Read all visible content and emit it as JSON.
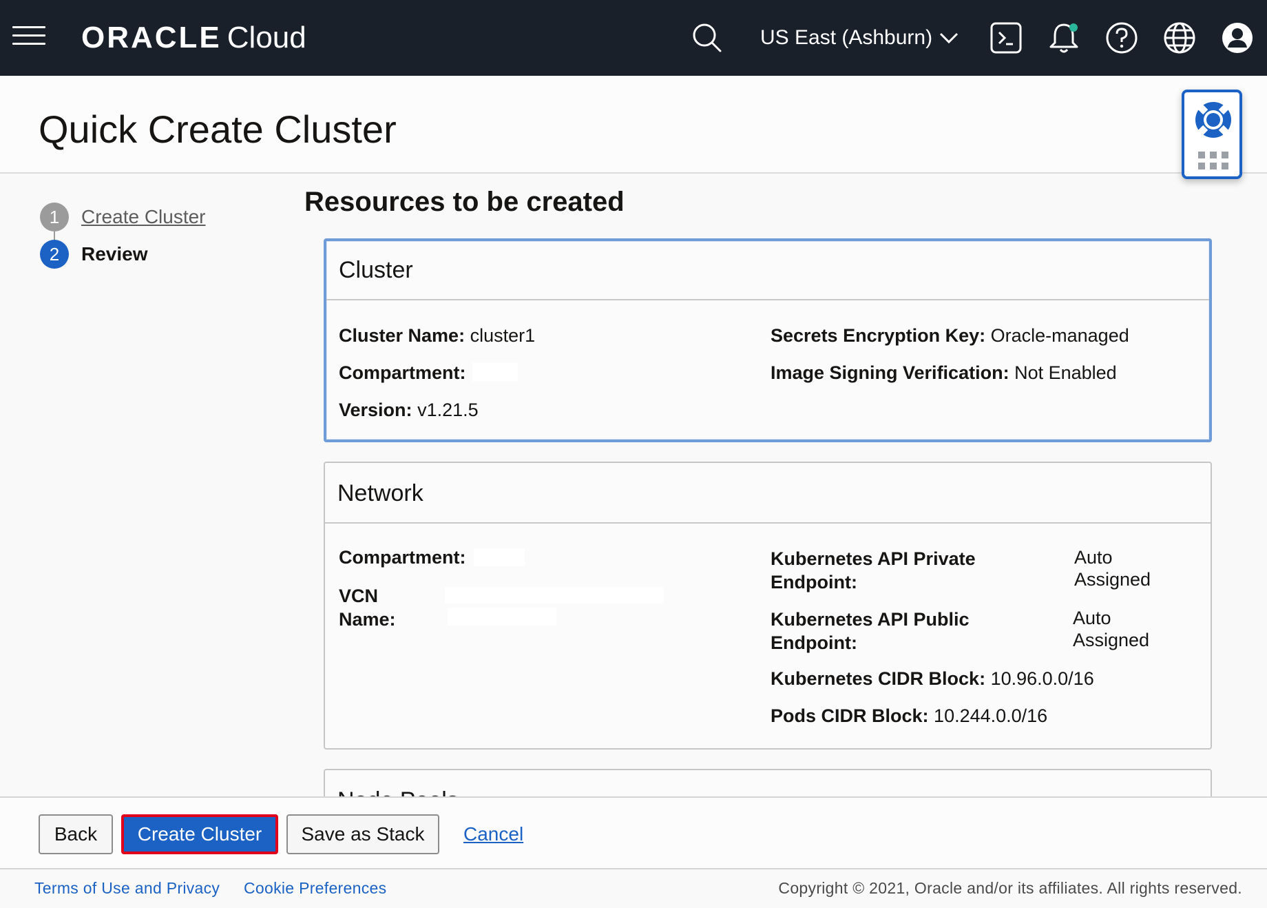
{
  "header": {
    "brand_oracle": "ORACLE",
    "brand_cloud": "Cloud",
    "region": "US East (Ashburn)"
  },
  "page": {
    "title": "Quick Create Cluster",
    "section_heading": "Resources to be created"
  },
  "steps": [
    {
      "number": "1",
      "label": "Create Cluster",
      "state": "completed"
    },
    {
      "number": "2",
      "label": "Review",
      "state": "current"
    }
  ],
  "cluster_panel": {
    "title": "Cluster",
    "cluster_name_label": "Cluster Name:",
    "cluster_name_value": "cluster1",
    "compartment_label": "Compartment:",
    "version_label": "Version:",
    "version_value": "v1.21.5",
    "secrets_label": "Secrets Encryption Key:",
    "secrets_value": "Oracle-managed",
    "image_signing_label": "Image Signing Verification:",
    "image_signing_value": "Not Enabled"
  },
  "network_panel": {
    "title": "Network",
    "compartment_label": "Compartment:",
    "vcn_label_line1": "VCN",
    "vcn_label_line2": "Name:",
    "api_private_label_line1": "Kubernetes API Private",
    "api_private_label_line2": "Endpoint:",
    "api_private_value_line1": "Auto",
    "api_private_value_line2": "Assigned",
    "api_public_label_line1": "Kubernetes API Public",
    "api_public_label_line2": "Endpoint:",
    "api_public_value_line1": "Auto",
    "api_public_value_line2": "Assigned",
    "k8s_cidr_label": "Kubernetes CIDR Block:",
    "k8s_cidr_value": "10.96.0.0/16",
    "pods_cidr_label": "Pods CIDR Block:",
    "pods_cidr_value": "10.244.0.0/16"
  },
  "node_pools_panel": {
    "title": "Node Pools"
  },
  "actions": {
    "back": "Back",
    "create_cluster": "Create Cluster",
    "save_as_stack": "Save as Stack",
    "cancel": "Cancel"
  },
  "footer": {
    "terms": "Terms of Use and Privacy",
    "cookies": "Cookie Preferences",
    "copyright": "Copyright © 2021, Oracle and/or its affiliates. All rights reserved."
  },
  "colors": {
    "header_bg": "#1a202a",
    "accent_blue": "#1b62c4",
    "highlight_red": "#e0001b",
    "notification_dot": "#2bb59a"
  }
}
